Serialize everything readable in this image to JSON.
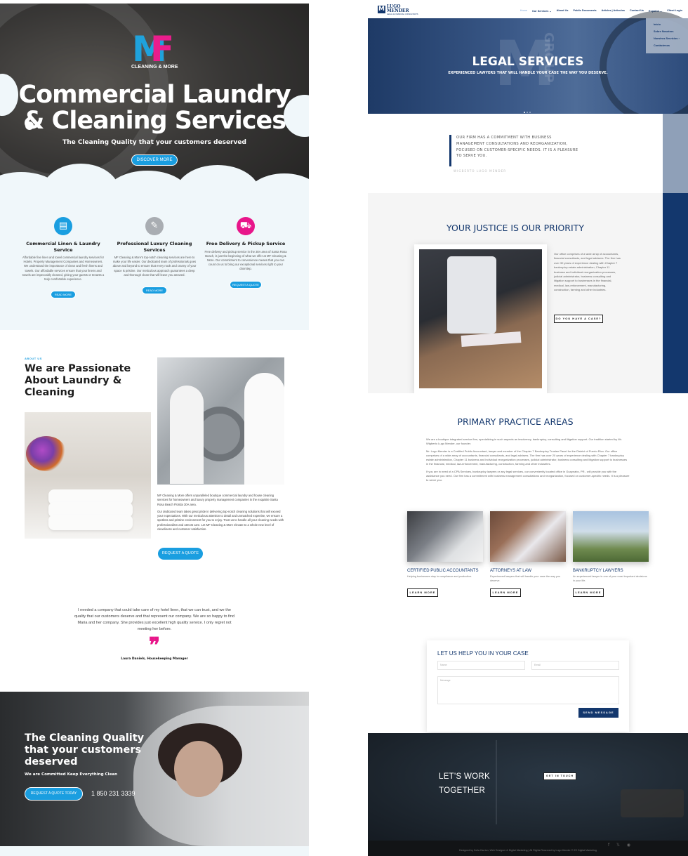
{
  "left_site": {
    "logo": {
      "m": "M",
      "f": "F",
      "text": "CLEANING & MORE"
    },
    "hero": {
      "title": "Commercial Laundry & Cleaning Services",
      "subtitle": "The Cleaning Quality that your customers deserved",
      "cta": "DISCOVER MORE"
    },
    "services": [
      {
        "icon": "linen-icon",
        "glyph": "▤",
        "color": "#1a9ee0",
        "title": "Commercial Linen & Laundry Service",
        "text": "Affordable fine linen and towel commercial laundry services for Hotels, Property Management Companies and Homeowners. We understand the importance of clean and fresh linens and towels. Our affordable services ensure that your linens and towels are impeccably cleaned, giving your guests or tenants a truly comfortable experience.",
        "button": "READ MORE"
      },
      {
        "icon": "vacuum-icon",
        "glyph": "✎",
        "color": "#a9adb2",
        "title": "Professional Luxury Cleaning Services",
        "text": "MF Cleaning & More's top-notch cleaning services are here to make your life easier. Our dedicated team of professionals goes above and beyond to ensure that every nook and cranny of your space is pristine. Our meticulous approach guarantees a deep and thorough clean that will leave you amazed.",
        "button": "READ MORE"
      },
      {
        "icon": "truck-icon",
        "glyph": "⛟",
        "color": "#e8168a",
        "title": "Free Delivery & Pickup Service",
        "text": "Free delivery and pickup service in the 30A area of Santa Rosa Beach, is just the beginning of what we offer at MF Cleaning & More. Our commitment to convenience means that you can count on us to bring our exceptional services right to your doorstep.",
        "button": "REQUEST A QUOTE"
      }
    ],
    "about": {
      "tag": "ABOUT US",
      "title": "We are Passionate About Laundry & Cleaning",
      "p1": "MF Cleaning & More offers unparalleled boutique commercial laundry and house cleaning services for homeowners and luxury property management companies in the exquisite Santa Rosa Beach Florida 30A area.",
      "p2": "Our dedicated team takes great pride in delivering top-notch cleaning solutions that will exceed your expectations. With our meticulous attention to detail and unmatched expertise, we ensure a spotless and pristine environment for you to enjoy. Trust us to handle all your cleaning needs with professionalism and utmost care. Let MF Cleaning & More elevate to a whole new level of cleanliness and customer satisfaction.",
      "cta": "REQUEST A QUOTE"
    },
    "testimonial": {
      "quote": "I needed a company that could take care of my hotel linen, that we can trust, and we the quality that our customers deserve and that represent our company. We are so happy to find Maria and her company. She provides just excellent high quality service. I only regret not meeting her before.",
      "mark": "❞",
      "author": "Laura Daniels, Housekeeping Manager"
    },
    "band": {
      "title": "The Cleaning Quality that your customers deserved",
      "subtitle": "We are Committed Keep Everything Clean",
      "cta": "REQUEST A QUOTE TODAY",
      "phone": "1 850 231 3339"
    }
  },
  "right_site": {
    "logo": {
      "mark": "M",
      "name1": "LUGO",
      "name2": "MENDER",
      "sub": "LEGAL & FINANCIAL CONSULTANTS"
    },
    "nav": [
      "Home",
      "Our Services ⌄",
      "About Us",
      "Public Documents",
      "Articles | Articulos",
      "Contact Us",
      "Español ⌄",
      "Client Login"
    ],
    "dropdown": [
      "Inicio",
      "Sobre Nosotros",
      "Nuestros Servicios ›",
      "Contáctenos"
    ],
    "hero": {
      "title": "LEGAL SERVICES",
      "subtitle": "EXPERIENCED LAWYERS THAT WILL HANDLE YOUR CASE THE WAY YOU DESERVE.",
      "watermark": "M",
      "watermark2": "GROUP"
    },
    "quote": {
      "text": "OUR FIRM HAS A COMMITMENT WITH BUSINESS MANAGEMENT CONSULTATIONS AND REORGANIZATION, FOCUSED ON CUSTOMER-SPECIFIC NEEDS. IT IS A PLEASURE TO SERVE YOU.",
      "author": "WIGBERTO LUGO MENDER"
    },
    "justice": {
      "title": "YOUR JUSTICE IS OUR PRIORITY",
      "text": "Our office comprises of a wide array of accountants, financial consultants, and legal advisers. The firm has over 30 years of experience dealing with Chapter 7 bankruptcy estate administration, Chapter 11 business and individual reorganization processes, judicial administrator, business consulting and litigation support to businesses in the financial, medical, law-enforcement, manufacturing, construction, farming and other industries.",
      "cta": "DO YOU HAVE A CASE?"
    },
    "practice": {
      "title": "PRIMARY PRACTICE AREAS",
      "p1": "We are a boutique integrated service firm, specializing in such aspects as insolvency, bankruptcy, consulting and litigation support. Our tradition started by Mr. Wigberto Lugo Mender, our founder.",
      "p2": "Mr. Lugo Mender is a Certified Public Accountant, lawyer and member of the Chapter 7 Bankruptcy Trustee Panel for the District of Puerto Rico. Our office comprises of a wide array of accountants, financial consultants, and legal advisers. The firm has over 20 years of experience dealing with Chapter 7 bankruptcy estate administration, Chapter 11 business and individual reorganization processes, judicial administrator, business consulting and litigation support to businesses in the financial, medical, law-enforcement, manufacturing, construction, farming and other industries.",
      "p3": "If you are in need of a CPA Services, bankruptcy lawyers or any legal services, our conveniently located office in Guaynabo, PR., will provide you with the assistance you need. Our firm has a commitment with business management consultations and reorganization, focused on customer-specific needs. It is a pleasure to serve you.",
      "cards": [
        {
          "title": "CERTIFIED PUBLIC ACCOUNTANTS",
          "text": "Helping businesses stay in compliance and productive.",
          "button": "LEARN MORE"
        },
        {
          "title": "ATTORNEYS AT LAW",
          "text": "Experienced lawyers that will handle your case the way you deserve.",
          "button": "LEARN MORE"
        },
        {
          "title": "BANKRUPTCY LAWYERS",
          "text": "An experienced lawyer in one of your most important decisions in your life.",
          "button": "LEARN MORE"
        }
      ]
    },
    "contact": {
      "title": "LET US HELP YOU IN YOUR CASE",
      "name_placeholder": "Name",
      "email_placeholder": "Email",
      "message_placeholder": "Message",
      "send": "SEND MESSAGE"
    },
    "work": {
      "title": "LET'S WORK TOGETHER",
      "cta": "GET IN TOUCH"
    },
    "footer": {
      "social": "f 𝕏 ◉",
      "copyright": "Designed by Zoila Carrion, Web Designer & Digital Marketing | All Rights Reserved by Lugo Mender © ZC Digital Marketing"
    }
  }
}
